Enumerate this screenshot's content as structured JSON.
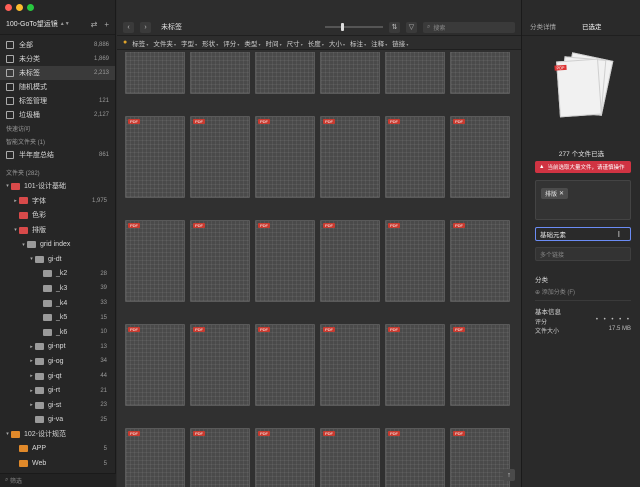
{
  "window": {
    "traffic_colors": [
      "#ff5f57",
      "#febc2e",
      "#28c840"
    ],
    "library_name": "100-GoTo望运镜"
  },
  "sidebar": {
    "nav": [
      {
        "label": "全部",
        "count": "8,886",
        "icon": "all-icon"
      },
      {
        "label": "未分类",
        "count": "1,869",
        "icon": "uncategorized-icon"
      },
      {
        "label": "未标签",
        "count": "2,213",
        "icon": "untagged-icon",
        "active": true
      },
      {
        "label": "随机模式",
        "count": "",
        "icon": "random-icon"
      },
      {
        "label": "标签管理",
        "count": "121",
        "icon": "tag-manage-icon"
      },
      {
        "label": "垃圾桶",
        "count": "2,127",
        "icon": "trash-icon"
      }
    ],
    "quick_access_label": "快速访问",
    "smart_folders_label": "智能文件夹 (1)",
    "smart_folder": {
      "label": "半年度总结",
      "count": "861"
    },
    "folders_label": "文件夹 (282)",
    "tree": [
      {
        "label": "101-设计基础",
        "count": "",
        "depth": 0,
        "arrow": "▾",
        "color": "#d84a4a"
      },
      {
        "label": "字体",
        "count": "1,975",
        "depth": 1,
        "arrow": "▸",
        "color": "#d84a4a"
      },
      {
        "label": "色彩",
        "count": "",
        "depth": 1,
        "arrow": "",
        "color": "#d84a4a"
      },
      {
        "label": "排版",
        "count": "",
        "depth": 1,
        "arrow": "▾",
        "color": "#d84a4a"
      },
      {
        "label": "grid index",
        "count": "",
        "depth": 2,
        "arrow": "▾",
        "color": "#9a9a9a"
      },
      {
        "label": "gi-dt",
        "count": "",
        "depth": 3,
        "arrow": "▾",
        "color": "#9a9a9a"
      },
      {
        "label": "_k2",
        "count": "28",
        "depth": 4,
        "arrow": "",
        "color": "#9a9a9a"
      },
      {
        "label": "_k3",
        "count": "39",
        "depth": 4,
        "arrow": "",
        "color": "#9a9a9a"
      },
      {
        "label": "_k4",
        "count": "33",
        "depth": 4,
        "arrow": "",
        "color": "#9a9a9a"
      },
      {
        "label": "_k5",
        "count": "15",
        "depth": 4,
        "arrow": "",
        "color": "#9a9a9a"
      },
      {
        "label": "_k6",
        "count": "10",
        "depth": 4,
        "arrow": "",
        "color": "#9a9a9a"
      },
      {
        "label": "gi-npt",
        "count": "13",
        "depth": 3,
        "arrow": "▸",
        "color": "#9a9a9a"
      },
      {
        "label": "gi-og",
        "count": "34",
        "depth": 3,
        "arrow": "▸",
        "color": "#9a9a9a"
      },
      {
        "label": "gi-qt",
        "count": "44",
        "depth": 3,
        "arrow": "▸",
        "color": "#9a9a9a"
      },
      {
        "label": "gi-rt",
        "count": "21",
        "depth": 3,
        "arrow": "▸",
        "color": "#9a9a9a"
      },
      {
        "label": "gi-st",
        "count": "23",
        "depth": 3,
        "arrow": "▸",
        "color": "#9a9a9a"
      },
      {
        "label": "gi-va",
        "count": "25",
        "depth": 3,
        "arrow": "",
        "color": "#9a9a9a"
      },
      {
        "label": "102-设计规范",
        "count": "",
        "depth": 0,
        "arrow": "▾",
        "color": "#e0892a"
      },
      {
        "label": "APP",
        "count": "5",
        "depth": 1,
        "arrow": "",
        "color": "#e0892a"
      },
      {
        "label": "Web",
        "count": "5",
        "depth": 1,
        "arrow": "",
        "color": "#e0892a"
      }
    ],
    "filter_placeholder": "筛选"
  },
  "main": {
    "title": "未标签",
    "slider_value": 0.28,
    "search_placeholder": "搜索",
    "filters": [
      "标签",
      "文件夹",
      "字型",
      "形状",
      "评分",
      "类型",
      "时间",
      "尺寸",
      "长度",
      "大小",
      "标注",
      "注释",
      "链接"
    ]
  },
  "inspector": {
    "tabs": [
      "分类详情",
      "已选定"
    ],
    "file_badge": "PDF",
    "selected_count": "277 个文件已选",
    "warning": "当前选取大量文件，请谨慎操作",
    "tag": "排版",
    "name_value": "基础元素",
    "link_placeholder": "多个链接",
    "category_label": "分类",
    "add_category": "添加分类 (F)",
    "basic_info_label": "基本信息",
    "rating_label": "评分",
    "rating_stars": "• • • • •",
    "file_size_label": "文件大小",
    "file_size_value": "17.5 MB"
  }
}
